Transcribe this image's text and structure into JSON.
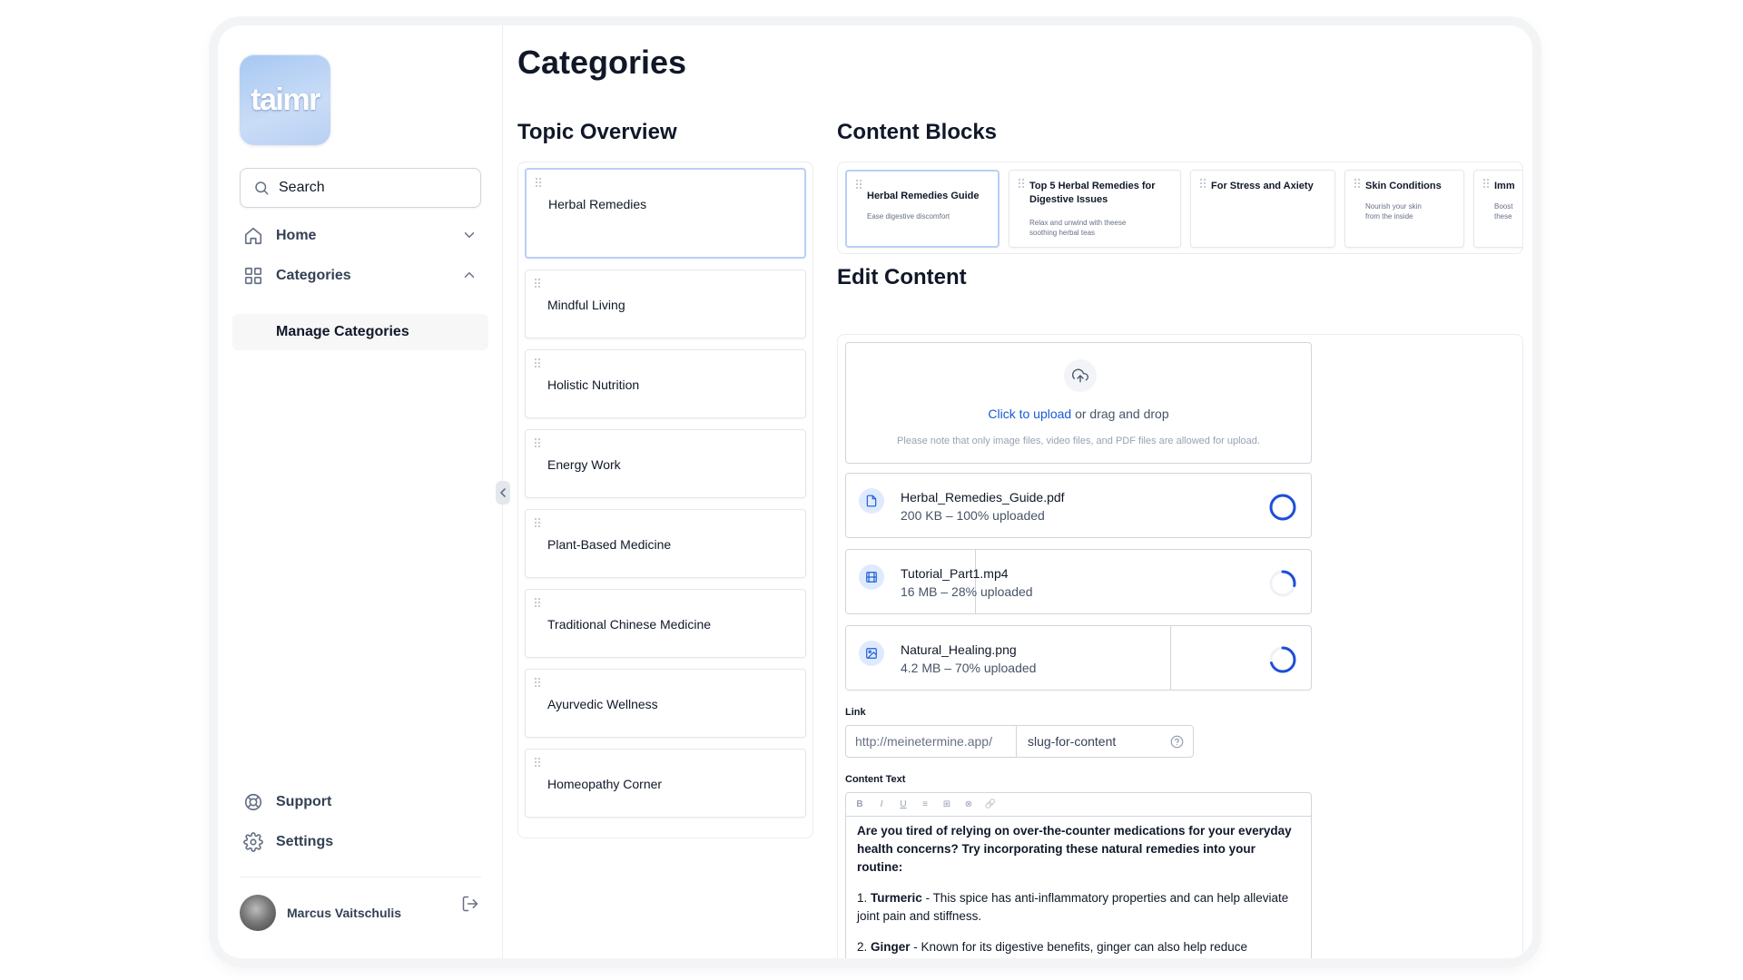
{
  "logo": {
    "text": "taimr"
  },
  "sidebar": {
    "search_label": "Search",
    "nav": [
      {
        "label": "Home"
      },
      {
        "label": "Categories"
      }
    ],
    "sub_item": "Manage Categories",
    "support_label": "Support",
    "settings_label": "Settings",
    "user_name": "Marcus Vaitschulis"
  },
  "main": {
    "title": "Categories",
    "topic_overview_title": "Topic Overview",
    "content_blocks_title": "Content Blocks",
    "edit_content_title": "Edit Content"
  },
  "topics": [
    "Herbal Remedies",
    "Mindful Living",
    "Holistic Nutrition",
    "Energy Work",
    "Plant-Based Medicine",
    "Traditional Chinese Medicine",
    "Ayurvedic Wellness",
    "Homeopathy Corner"
  ],
  "blocks": [
    {
      "title": "Herbal Remedies Guide",
      "desc": "Ease digestive discomfort"
    },
    {
      "title": "Top 5 Herbal Remedies for Digestive Issues",
      "desc": "Relax and unwind with theese soothing herbal teas"
    },
    {
      "title": "For Stress and Axiety",
      "desc": ""
    },
    {
      "title": "Skin Conditions",
      "desc": "Nourish your skin from the inside"
    },
    {
      "title": "Imm",
      "desc": "Boost these"
    }
  ],
  "upload": {
    "link_text": "Click to upload",
    "rest_text": " or drag and drop",
    "note": "Please note that only image files, video files, and PDF files are allowed for upload."
  },
  "files": [
    {
      "name": "Herbal_Remedies_Guide.pdf",
      "meta": "200 KB – 100% uploaded",
      "progress": 1.0,
      "icon": "file-icon"
    },
    {
      "name": "Tutorial_Part1.mp4",
      "meta": "16 MB – 28% uploaded",
      "progress": 0.28,
      "icon": "video-icon"
    },
    {
      "name": "Natural_Healing.png",
      "meta": "4.2 MB – 70% uploaded",
      "progress": 0.7,
      "icon": "image-icon"
    }
  ],
  "link": {
    "label": "Link",
    "prefix": "http://meinetermine.app/",
    "slug": "slug-for-content"
  },
  "content_text": {
    "label": "Content Text",
    "toolbar": [
      "B",
      "I",
      "U",
      "≡",
      "⊞",
      "⊗",
      "🔗"
    ],
    "intro": "Are you tired of relying on over-the-counter medications for your everyday health concerns? Try incorporating these natural remedies into your routine:",
    "items": [
      {
        "num": "1.",
        "bold": "Turmeric",
        "text": " - This spice has anti-inflammatory properties and can help alleviate joint pain and stiffness."
      },
      {
        "num": "2.",
        "bold": "Ginger",
        "text": " - Known for its digestive benefits, ginger can also help reduce inflammation and boost the immune system."
      }
    ]
  },
  "colors": {
    "accent": "#175cd3",
    "ring": "#1d4ed8",
    "active_border": "#b9cff8"
  }
}
